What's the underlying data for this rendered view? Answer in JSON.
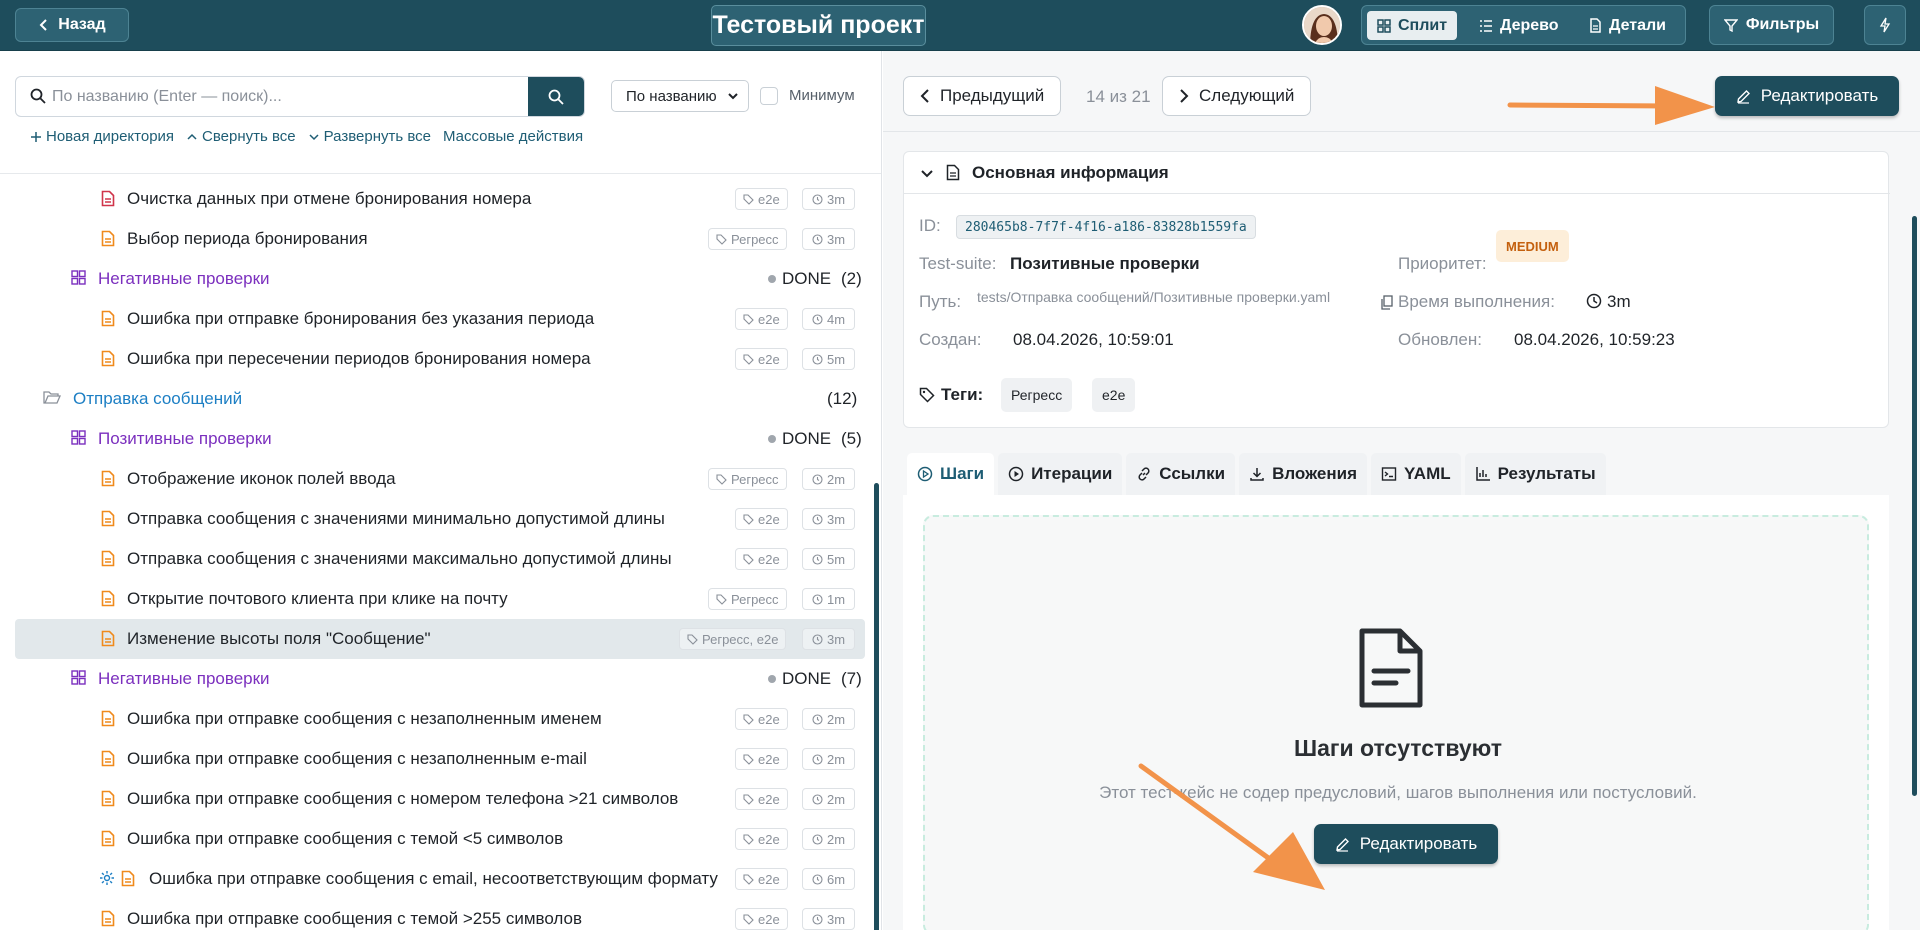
{
  "topbar": {
    "back_label": "Назад",
    "project_title": "Тестовый проект",
    "views": [
      {
        "label": "Сплит",
        "active": true
      },
      {
        "label": "Дерево",
        "active": false
      },
      {
        "label": "Детали",
        "active": false
      }
    ],
    "filters_label": "Фильтры"
  },
  "left": {
    "search_placeholder": "По названию (Enter — поиск)...",
    "sort_value": "По названию",
    "minimum_label": "Минимум",
    "actions": {
      "new_dir": "Новая директория",
      "collapse_all": "Свернуть все",
      "expand_all": "Развернуть все",
      "bulk": "Массовые действия"
    },
    "tree": [
      {
        "kind": "case",
        "title": "Очистка данных при отмене бронирования номера",
        "tag": "e2e",
        "time": "3m",
        "icon_color": "#d0344a"
      },
      {
        "kind": "case",
        "title": "Выбор периода бронирования",
        "tag": "Регресс",
        "time": "3m",
        "icon_color": "#f08a1c"
      },
      {
        "kind": "suite",
        "title": "Негативные проверки",
        "status": "DONE",
        "count": "(2)"
      },
      {
        "kind": "case",
        "title": "Ошибка при отправке бронирования без указания периода",
        "tag": "e2e",
        "time": "4m",
        "icon_color": "#f08a1c"
      },
      {
        "kind": "case",
        "title": "Ошибка при пересечении периодов бронирования номера",
        "tag": "e2e",
        "time": "5m",
        "icon_color": "#f08a1c"
      },
      {
        "kind": "folder",
        "title": "Отправка сообщений",
        "count": "(12)"
      },
      {
        "kind": "suite",
        "title": "Позитивные проверки",
        "status": "DONE",
        "count": "(5)"
      },
      {
        "kind": "case",
        "title": "Отображение иконок полей ввода",
        "tag": "Регресс",
        "time": "2m",
        "icon_color": "#f08a1c"
      },
      {
        "kind": "case",
        "title": "Отправка сообщения с значениями минимально допустимой длины",
        "tag": "e2e",
        "time": "3m",
        "icon_color": "#f08a1c"
      },
      {
        "kind": "case",
        "title": "Отправка сообщения с значениями максимально допустимой длины",
        "tag": "e2e",
        "time": "5m",
        "icon_color": "#f08a1c"
      },
      {
        "kind": "case",
        "title": "Открытие почтового клиента при клике на почту",
        "tag": "Регресс",
        "time": "1m",
        "icon_color": "#f08a1c"
      },
      {
        "kind": "case",
        "title": "Изменение высоты поля \"Сообщение\"",
        "tag": "Регресс, e2e",
        "time": "3m",
        "icon_color": "#f08a1c",
        "selected": true
      },
      {
        "kind": "suite",
        "title": "Негативные проверки",
        "status": "DONE",
        "count": "(7)"
      },
      {
        "kind": "case",
        "title": "Ошибка при отправке сообщения с незаполненным именем",
        "tag": "e2e",
        "time": "2m",
        "icon_color": "#f08a1c"
      },
      {
        "kind": "case",
        "title": "Ошибка при отправке сообщения с незаполненным e-mail",
        "tag": "e2e",
        "time": "2m",
        "icon_color": "#f08a1c"
      },
      {
        "kind": "case",
        "title": "Ошибка при отправке сообщения с номером телефона >21 символов",
        "tag": "e2e",
        "time": "2m",
        "icon_color": "#f08a1c"
      },
      {
        "kind": "case",
        "title": "Ошибка при отправке сообщения с темой <5 символов",
        "tag": "e2e",
        "time": "2m",
        "icon_color": "#f08a1c"
      },
      {
        "kind": "case",
        "title": "Ошибка при отправке сообщения с email, несоответствующим формату",
        "tag": "e2e",
        "time": "6m",
        "icon_color": "#f08a1c",
        "automated": true
      },
      {
        "kind": "case",
        "title": "Ошибка при отправке сообщения с темой >255 символов",
        "tag": "e2e",
        "time": "3m",
        "icon_color": "#f08a1c"
      }
    ]
  },
  "right": {
    "prev_label": "Предыдущий",
    "counter": "14 из 21",
    "next_label": "Следующий",
    "edit_label": "Редактировать",
    "info": {
      "section_title": "Основная информация",
      "id_label": "ID:",
      "id_value": "280465b8-7f7f-4f16-a186-83828b1559fa",
      "suite_label": "Test-suite:",
      "suite_value": "Позитивные проверки",
      "priority_label": "Приоритет:",
      "priority_value": "MEDIUM",
      "path_label": "Путь:",
      "path_value": "tests/Отправка сообщений/Позитивные проверки.yaml",
      "duration_label": "Время выполнения:",
      "duration_value": "3m",
      "created_label": "Создан:",
      "created_value": "08.04.2026, 10:59:01",
      "updated_label": "Обновлен:",
      "updated_value": "08.04.2026, 10:59:23",
      "tags_label": "Теги:",
      "tags": [
        "Регресс",
        "e2e"
      ]
    },
    "tabs": [
      {
        "label": "Шаги",
        "icon": "play-circle-icon",
        "active": true
      },
      {
        "label": "Итерации",
        "icon": "play-icon",
        "active": false
      },
      {
        "label": "Ссылки",
        "icon": "link-icon",
        "active": false
      },
      {
        "label": "Вложения",
        "icon": "download-icon",
        "active": false
      },
      {
        "label": "YAML",
        "icon": "terminal-icon",
        "active": false
      },
      {
        "label": "Результаты",
        "icon": "bar-chart-icon",
        "active": false
      }
    ],
    "empty": {
      "title": "Шаги отсутствуют",
      "subtitle": "Этот тест-кейс не содер     предусловий, шагов выполнения или постусловий."
    }
  },
  "colors": {
    "primary": "#1e4d5c",
    "folder": "#1d7fc4",
    "suite": "#7b2fbe",
    "case_icon": "#f08a1c",
    "annotation_arrow": "#f2934a"
  }
}
